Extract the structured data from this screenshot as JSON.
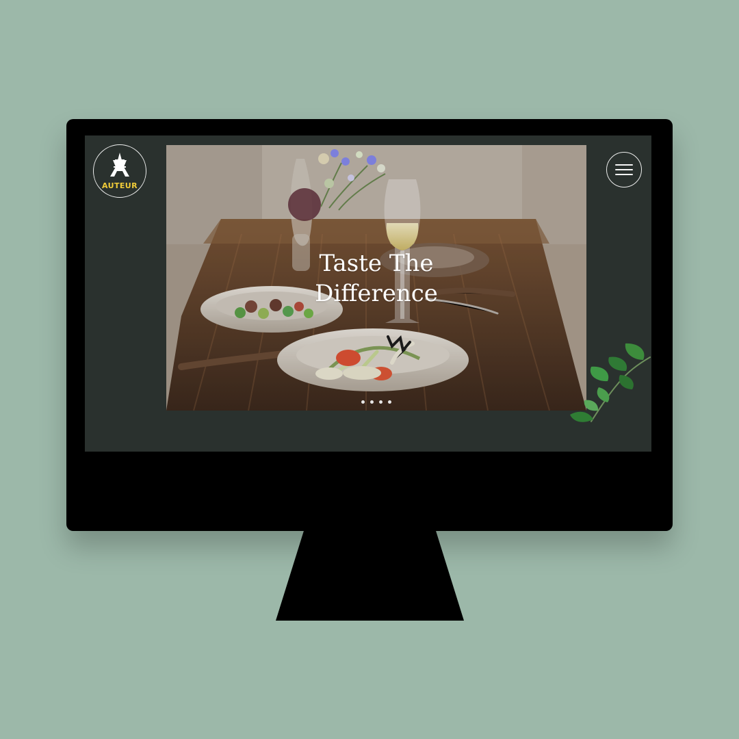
{
  "brand": {
    "logo_text": "AUTEUR"
  },
  "hero": {
    "title": "Taste The Difference",
    "slides": [
      {
        "active": true
      },
      {
        "active": false
      },
      {
        "active": false
      },
      {
        "active": false
      }
    ]
  },
  "icons": {
    "logo": "eiffel-tower-icon",
    "menu": "hamburger-menu-icon",
    "decoration": "leaf-branch-icon"
  },
  "colors": {
    "background": "#9cb8a9",
    "monitor": "#000000",
    "screen": "#2a312e",
    "logo_text": "#f1cc39",
    "line": "#ffffff"
  }
}
